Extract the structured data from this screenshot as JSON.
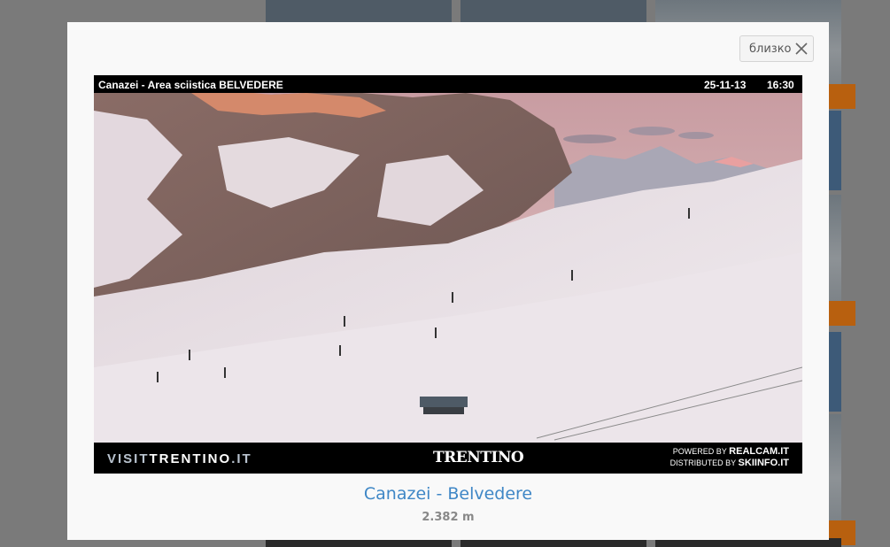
{
  "modal": {
    "close_label": "близко",
    "title": "Canazei - Belvedere",
    "altitude": "2.382 m"
  },
  "webcam": {
    "overlay_title": "Canazei - Area sciistica BELVEDERE",
    "date": "25-11-13",
    "time": "16:30",
    "footer": {
      "visit_prefix": "VISIT",
      "visit_brand": "TRENTINO",
      "visit_suffix": ".IT",
      "logo": "TRENTINO",
      "powered_prefix": "POWERED BY",
      "powered_by": "REALCAM.IT",
      "distributed_prefix": "DISTRIBUTED BY",
      "distributed_by": "SKIINFO.IT"
    }
  },
  "icons": {
    "close": "close-icon"
  },
  "colors": {
    "title_link": "#3f87c6",
    "accent_orange": "#b8600f",
    "backdrop": "#7a7a7a"
  }
}
